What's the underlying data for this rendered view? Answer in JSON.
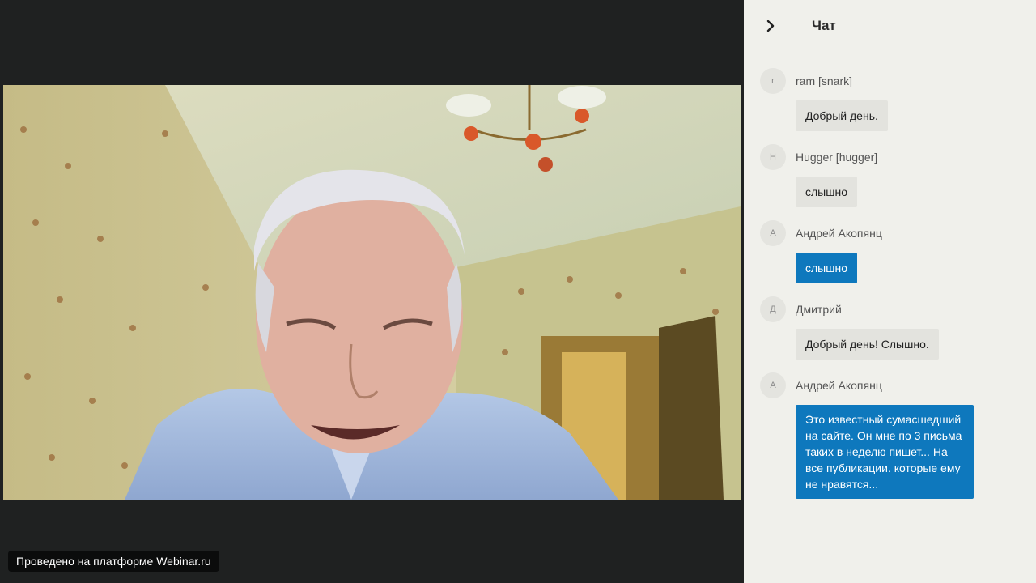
{
  "app": {
    "platform_badge": "Проведено на платформе Webinar.ru"
  },
  "chat": {
    "title": "Чат",
    "messages": [
      {
        "avatar": "r",
        "author": "ram [snark]",
        "text": "Добрый день.",
        "own": false
      },
      {
        "avatar": "H",
        "author": "Hugger [hugger]",
        "text": "слышно",
        "own": false
      },
      {
        "avatar": "А",
        "author": "Андрей Акопянц",
        "text": "слышно",
        "own": true
      },
      {
        "avatar": "Д",
        "author": "Дмитрий",
        "text": "Добрый день! Слышно.",
        "own": false
      },
      {
        "avatar": "А",
        "author": "Андрей Акопянц",
        "text": "Это известный сумасшедший на сайте. Он мне по 3 письма таких в неделю пишет... На все публикации.   которые ему не нравятся...",
        "own": true
      }
    ]
  },
  "colors": {
    "stage_bg": "#1f2121",
    "chat_bg": "#f0f0eb",
    "own_bubble": "#0e78bd",
    "other_bubble": "#e3e3de"
  },
  "icons": {
    "collapse": "chevron-right-icon"
  }
}
